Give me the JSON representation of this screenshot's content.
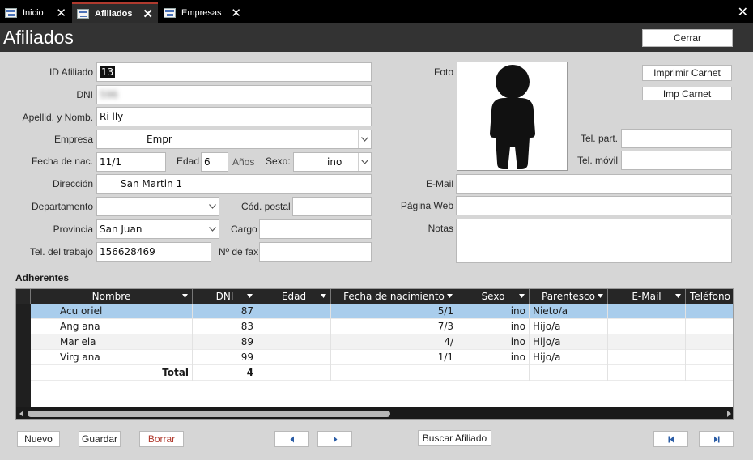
{
  "tabs": [
    {
      "label": "Inicio"
    },
    {
      "label": "Afiliados"
    },
    {
      "label": "Empresas"
    }
  ],
  "page": {
    "title": "Afiliados",
    "close_label": "Cerrar"
  },
  "form": {
    "id_label": "ID Afiliado",
    "id_value": "13",
    "dni_label": "DNI",
    "dni_value": "596",
    "nombre_label": "Apellid. y Nomb.",
    "nombre_value": "Ri lly",
    "empresa_label": "Empresa",
    "empresa_value": "Empr",
    "fecha_label": "Fecha de nac.",
    "fecha_value": "11/1",
    "edad_label": "Edad",
    "edad_value": "6",
    "anios_label": "Años",
    "sexo_label": "Sexo:",
    "sexo_value": "ino",
    "direccion_label": "Dirección",
    "direccion_value": "San Martin 1",
    "departamento_label": "Departamento",
    "departamento_value": "",
    "codpostal_label": "Cód. postal",
    "codpostal_value": "",
    "provincia_label": "Provincia",
    "provincia_value": "San Juan",
    "cargo_label": "Cargo",
    "cargo_value": "",
    "teltrabajo_label": "Tel. del trabajo",
    "teltrabajo_value": "156628469",
    "fax_label": "Nº de fax",
    "fax_value": "",
    "foto_label": "Foto",
    "imprimir_carnet_label": "Imprimir Carnet",
    "imp_carnet_label": "Imp Carnet",
    "telpart_label": "Tel. part.",
    "telpart_value": "",
    "telmovil_label": "Tel. móvil",
    "telmovil_value": "",
    "email_label": "E-Mail",
    "email_value": "",
    "web_label": "Página Web",
    "web_value": "",
    "notas_label": "Notas",
    "notas_value": ""
  },
  "adherentes": {
    "title": "Adherentes",
    "columns": [
      "Nombre",
      "DNI",
      "Edad",
      "Fecha de nacimiento",
      "Sexo",
      "Parentesco",
      "E-Mail",
      "Teléfono"
    ],
    "rows": [
      {
        "nombre": "Acu oriel",
        "dni": "87",
        "edad": "",
        "fecha": "5/1",
        "sexo": "ino",
        "parentesco": "Nieto/a"
      },
      {
        "nombre": "Ang ana",
        "dni": "83",
        "edad": "",
        "fecha": "7/3",
        "sexo": "ino",
        "parentesco": "Hijo/a"
      },
      {
        "nombre": "Mar ela",
        "dni": "89",
        "edad": "",
        "fecha": "4/",
        "sexo": "ino",
        "parentesco": "Hijo/a"
      },
      {
        "nombre": "Virg ana",
        "dni": "99",
        "edad": "",
        "fecha": "1/1",
        "sexo": "ino",
        "parentesco": "Hijo/a"
      }
    ],
    "total_label": "Total",
    "total_value": "4"
  },
  "footer": {
    "nuevo": "Nuevo",
    "guardar": "Guardar",
    "borrar": "Borrar",
    "buscar": "Buscar Afiliado"
  },
  "colors": {
    "accent_red": "#b03a2e",
    "selected_row": "#a9cdec",
    "header_dark": "#333333"
  }
}
